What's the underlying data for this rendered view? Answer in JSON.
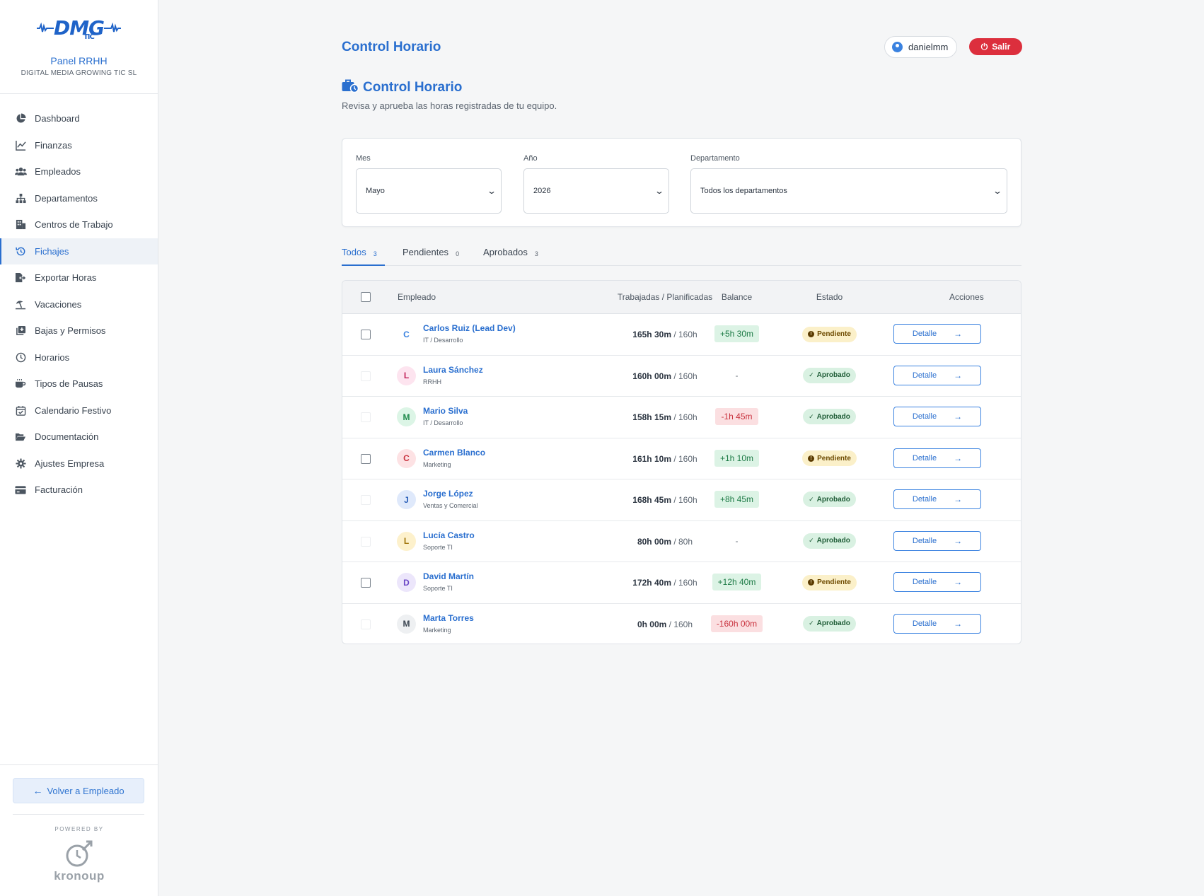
{
  "brand": {
    "logo_text": "DMG",
    "logo_sub": "TIC",
    "title": "Panel RRHH",
    "company": "DIGITAL MEDIA GROWING TIC SL"
  },
  "nav": [
    {
      "label": "Dashboard",
      "icon": "pie-chart-icon",
      "active": false
    },
    {
      "label": "Finanzas",
      "icon": "line-chart-icon",
      "active": false
    },
    {
      "label": "Empleados",
      "icon": "users-icon",
      "active": false
    },
    {
      "label": "Departamentos",
      "icon": "sitemap-icon",
      "active": false
    },
    {
      "label": "Centros de Trabajo",
      "icon": "building-icon",
      "active": false
    },
    {
      "label": "Fichajes",
      "icon": "history-icon",
      "active": true
    },
    {
      "label": "Exportar Horas",
      "icon": "export-file-icon",
      "active": false
    },
    {
      "label": "Vacaciones",
      "icon": "umbrella-beach-icon",
      "active": false
    },
    {
      "label": "Bajas y Permisos",
      "icon": "medical-notes-icon",
      "active": false
    },
    {
      "label": "Horarios",
      "icon": "clock-icon",
      "active": false
    },
    {
      "label": "Tipos de Pausas",
      "icon": "coffee-icon",
      "active": false
    },
    {
      "label": "Calendario Festivo",
      "icon": "calendar-check-icon",
      "active": false
    },
    {
      "label": "Documentación",
      "icon": "folder-open-icon",
      "active": false
    },
    {
      "label": "Ajustes Empresa",
      "icon": "gear-icon",
      "active": false
    },
    {
      "label": "Facturación",
      "icon": "credit-card-icon",
      "active": false
    }
  ],
  "sidebar_bottom": {
    "back_label": "Volver a Empleado",
    "powered_by": "POWERED BY",
    "powered_brand": "kronoup"
  },
  "header": {
    "title": "Control Horario",
    "user": "danielmm",
    "exit_label": "Salir"
  },
  "page": {
    "title": "Control Horario",
    "description": "Revisa y aprueba las horas registradas de tu equipo."
  },
  "filters": {
    "month_label": "Mes",
    "month_value": "Mayo",
    "year_label": "Año",
    "year_value": "2026",
    "dept_label": "Departamento",
    "dept_value": "Todos los departamentos"
  },
  "tabs": [
    {
      "label": "Todos",
      "count": "3",
      "active": true
    },
    {
      "label": "Pendientes",
      "count": "0",
      "active": false
    },
    {
      "label": "Aprobados",
      "count": "3",
      "active": false
    }
  ],
  "table": {
    "headers": {
      "employee": "Empleado",
      "hours": "Trabajadas / Planificadas",
      "balance": "Balance",
      "status": "Estado",
      "actions": "Acciones"
    },
    "detail_label": "Detalle",
    "rows": [
      {
        "initial": "C",
        "name": "Carlos Ruiz (Lead Dev)",
        "dept": "IT / Desarrollo",
        "worked": "165h 30m",
        "planned": "/ 160h",
        "balance": "+5h 30m",
        "balance_type": "pos",
        "status": "Pendiente",
        "status_type": "pend",
        "selectable": true,
        "avatar_bg": "#ffffff",
        "avatar_fg": "#3a82e0"
      },
      {
        "initial": "L",
        "name": "Laura Sánchez",
        "dept": "RRHH",
        "worked": "160h 00m",
        "planned": "/ 160h",
        "balance": "-",
        "balance_type": "none",
        "status": "Aprobado",
        "status_type": "apr",
        "selectable": false,
        "avatar_bg": "#fde4ef",
        "avatar_fg": "#c2255c"
      },
      {
        "initial": "M",
        "name": "Mario Silva",
        "dept": "IT / Desarrollo",
        "worked": "158h 15m",
        "planned": "/ 160h",
        "balance": "-1h 45m",
        "balance_type": "neg",
        "status": "Aprobado",
        "status_type": "apr",
        "selectable": false,
        "avatar_bg": "#dcf5e6",
        "avatar_fg": "#1f8a4c"
      },
      {
        "initial": "C",
        "name": "Carmen Blanco",
        "dept": "Marketing",
        "worked": "161h 10m",
        "planned": "/ 160h",
        "balance": "+1h 10m",
        "balance_type": "pos",
        "status": "Pendiente",
        "status_type": "pend",
        "selectable": true,
        "avatar_bg": "#fde2e4",
        "avatar_fg": "#c9333f"
      },
      {
        "initial": "J",
        "name": "Jorge López",
        "dept": "Ventas y Comercial",
        "worked": "168h 45m",
        "planned": "/ 160h",
        "balance": "+8h 45m",
        "balance_type": "pos",
        "status": "Aprobado",
        "status_type": "apr",
        "selectable": false,
        "avatar_bg": "#dfe9fb",
        "avatar_fg": "#2a5fb8"
      },
      {
        "initial": "L",
        "name": "Lucía Castro",
        "dept": "Soporte TI",
        "worked": "80h 00m",
        "planned": "/ 80h",
        "balance": "-",
        "balance_type": "none",
        "status": "Aprobado",
        "status_type": "apr",
        "selectable": false,
        "avatar_bg": "#fdf1cc",
        "avatar_fg": "#a0740a"
      },
      {
        "initial": "D",
        "name": "David Martín",
        "dept": "Soporte TI",
        "worked": "172h 40m",
        "planned": "/ 160h",
        "balance": "+12h 40m",
        "balance_type": "pos",
        "status": "Pendiente",
        "status_type": "pend",
        "selectable": true,
        "avatar_bg": "#ece6fb",
        "avatar_fg": "#6b47c6"
      },
      {
        "initial": "M",
        "name": "Marta Torres",
        "dept": "Marketing",
        "worked": "0h 00m",
        "planned": "/ 160h",
        "balance": "-160h 00m",
        "balance_type": "neg",
        "status": "Aprobado",
        "status_type": "apr",
        "selectable": false,
        "avatar_bg": "#eef0f2",
        "avatar_fg": "#3a4450"
      }
    ]
  },
  "colors": {
    "accent": "#2a6fcf",
    "danger": "#dc2f3d",
    "positive_bg": "#dcf3e5",
    "negative_bg": "#fbdfe1",
    "pending_bg": "#fbf0c9",
    "approved_bg": "#d9f1e2"
  }
}
